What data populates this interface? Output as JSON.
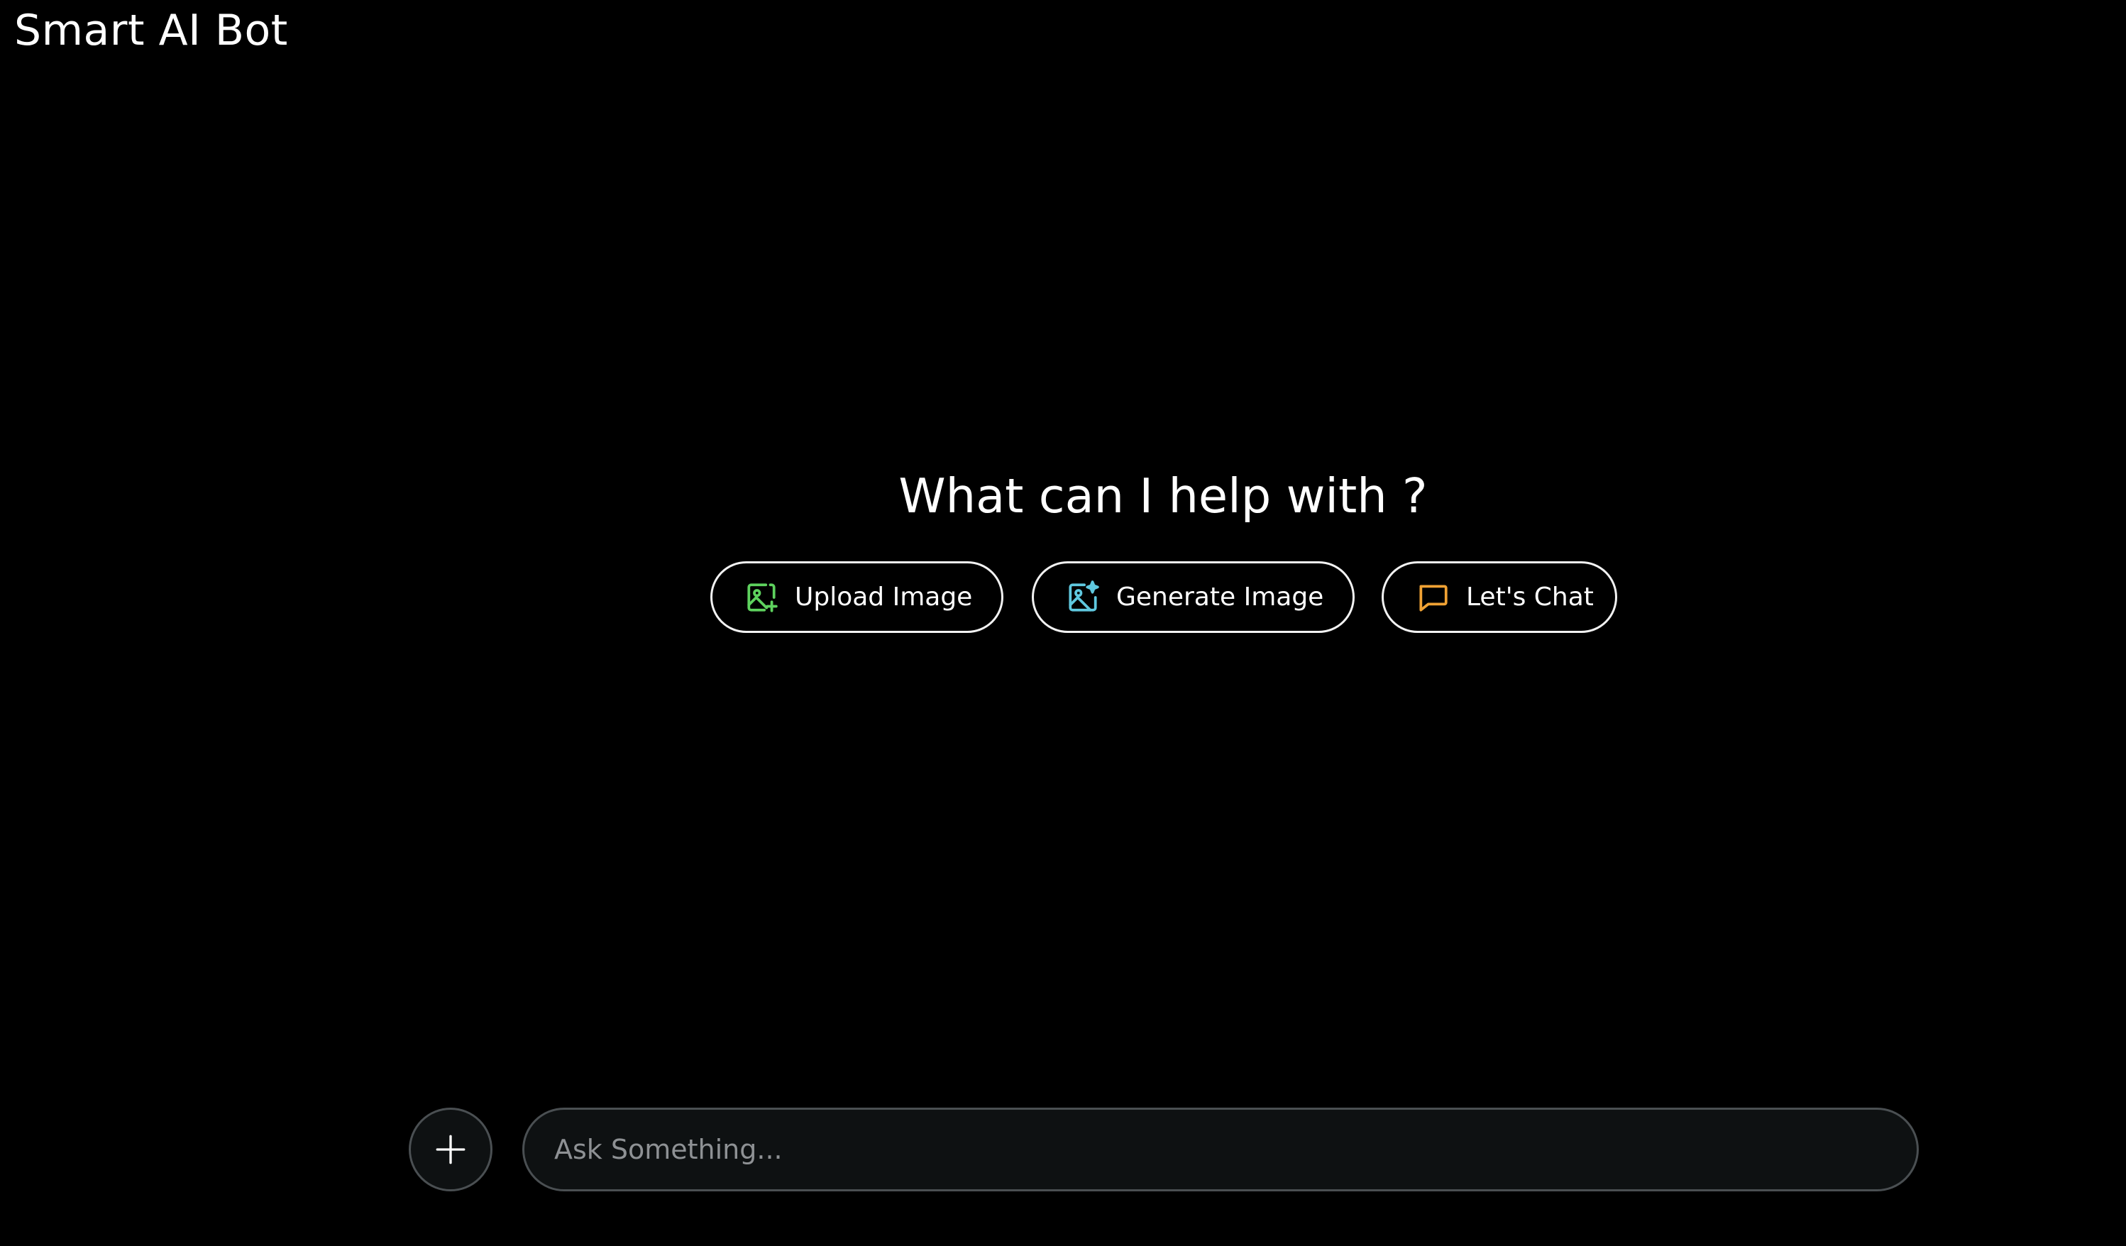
{
  "header": {
    "app_title": "Smart AI Bot"
  },
  "main": {
    "headline": "What can I help with ?",
    "actions": [
      {
        "label": "Upload Image",
        "icon": "image-plus-icon",
        "color": "#5ed25e"
      },
      {
        "label": "Generate Image",
        "icon": "image-sparkle-icon",
        "color": "#5fc8df"
      },
      {
        "label": "Let's Chat",
        "icon": "chat-bubble-icon",
        "color": "#f0a234"
      }
    ]
  },
  "composer": {
    "add_button_icon": "plus-icon",
    "input_placeholder": "Ask Something...",
    "input_value": ""
  },
  "colors": {
    "background": "#000000",
    "text": "#ffffff",
    "input_background": "#0e1112",
    "input_border": "#4a4f52",
    "placeholder": "#8e9194"
  }
}
